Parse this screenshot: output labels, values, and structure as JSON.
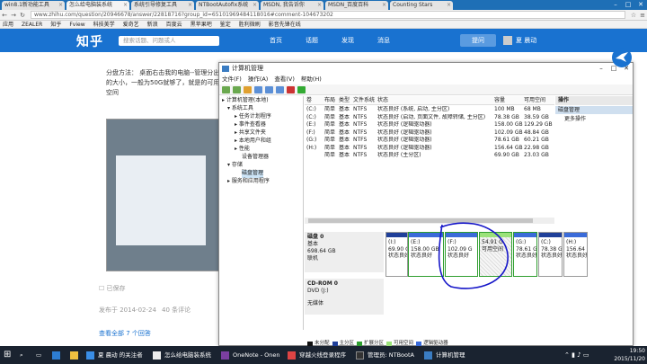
{
  "browser": {
    "tabs": [
      "win8.1新功能工具",
      "怎么给电脑装系统",
      "系统引导修复工具",
      "NTBootAutofix系统",
      "MSDN, 我告诉你",
      "MSDN_百度百科",
      "Counting Stars"
    ],
    "url": "www.zhihu.com/question/20946678/answer/22818716?group_id=65101969484118016#comment-104673202",
    "bookmarks": [
      "应用",
      "ZEALER",
      "知乎",
      "Fview",
      "科技美学",
      "爱奇艺",
      "新浪",
      "百度云",
      "黑苹果吧",
      "鉴定",
      "胜利微刷",
      "影音先锋在线"
    ]
  },
  "zhihu": {
    "logo": "知乎",
    "search_placeholder": "搜索话题、问题或人",
    "nav": [
      "首页",
      "话题",
      "发现",
      "消息"
    ],
    "ask": "提问",
    "user": "夏 晨动",
    "answer_text": "分盘方法： 桌面右击我的电脑--管理分出的大小，一般为50G就够了，就是的可用空间",
    "saved": "已保存",
    "posted": "发布于 2014-02-24",
    "likes": "40 条评论",
    "collapse": "查看全部 7 个回答"
  },
  "cm": {
    "title": "计算机管理",
    "menu": [
      "文件(F)",
      "操作(A)",
      "查看(V)",
      "帮助(H)"
    ],
    "tree": [
      "计算机管理(本地)",
      "系统工具",
      "任务计划程序",
      "事件查看器",
      "共享文件夹",
      "本地用户和组",
      "性能",
      "设备管理器",
      "存储",
      "磁盘管理",
      "服务和应用程序"
    ],
    "headers": [
      "卷",
      "布局",
      "类型",
      "文件系统",
      "状态",
      "容量",
      "可用空间"
    ],
    "rows": [
      [
        "(C:)",
        "简单",
        "基本",
        "NTFS",
        "状态良好 (系统, 启动, 主分区)",
        "100 MB",
        "68 MB"
      ],
      [
        "(C:)",
        "简单",
        "基本",
        "NTFS",
        "状态良好 (启动, 页面文件, 故障转储, 主分区)",
        "78.38 GB",
        "38.59 GB"
      ],
      [
        "(E:)",
        "简单",
        "基本",
        "NTFS",
        "状态良好 (逻辑驱动器)",
        "158.00 GB",
        "129.29 GB"
      ],
      [
        "(F:)",
        "简单",
        "基本",
        "NTFS",
        "状态良好 (逻辑驱动器)",
        "102.09 GB",
        "48.84 GB"
      ],
      [
        "(G:)",
        "简单",
        "基本",
        "NTFS",
        "状态良好 (逻辑驱动器)",
        "78.61 GB",
        "60.21 GB"
      ],
      [
        "(H:)",
        "简单",
        "基本",
        "NTFS",
        "状态良好 (逻辑驱动器)",
        "156.64 GB",
        "22.98 GB"
      ],
      [
        "",
        "简单",
        "基本",
        "NTFS",
        "状态良好 (主分区)",
        "69.90 GB",
        "23.03 GB"
      ]
    ],
    "disk0": {
      "name": "磁盘 0",
      "type": "基本",
      "size": "698.64 GB",
      "status": "联机"
    },
    "parts": [
      {
        "label": "(I:)",
        "size": "69.90 G",
        "status": "状态良好"
      },
      {
        "label": "(E:)",
        "size": "158.00 GB",
        "status": "状态良好"
      },
      {
        "label": "(F:)",
        "size": "102.09 G",
        "status": "状态良好"
      },
      {
        "label": "",
        "size": "54.91 G",
        "status": "可用空间"
      },
      {
        "label": "(G:)",
        "size": "78.61 G",
        "status": "状态良好"
      },
      {
        "label": "(C:)",
        "size": "78.38 G",
        "status": "状态良好"
      },
      {
        "label": "(H:)",
        "size": "156.64 G",
        "status": "状态良好"
      }
    ],
    "cdrom": {
      "name": "CD-ROM 0",
      "drive": "DVD (J:)",
      "media": "无媒体"
    },
    "legend": [
      "未分配",
      "主分区",
      "扩展分区",
      "可用空间",
      "逻辑驱动器"
    ],
    "actions": {
      "header": "操作",
      "section": "磁盘管理",
      "more": "更多操作"
    }
  },
  "taskbar": {
    "items": [
      "夏 晨动 的关注者",
      "怎么给电脑装系统",
      "OneNote - Onen",
      "穿越火线登录程序",
      "管理员: NTBootA",
      "计算机管理"
    ],
    "time": "19:50",
    "date": "2015/11/20"
  },
  "colors": {
    "zhihu_blue": "#1972d0",
    "primary": "#1f3f99",
    "logical": "#3a6bd9",
    "free": "#9be27a",
    "extended": "#2f9e2f",
    "pen": "#1515c8"
  }
}
